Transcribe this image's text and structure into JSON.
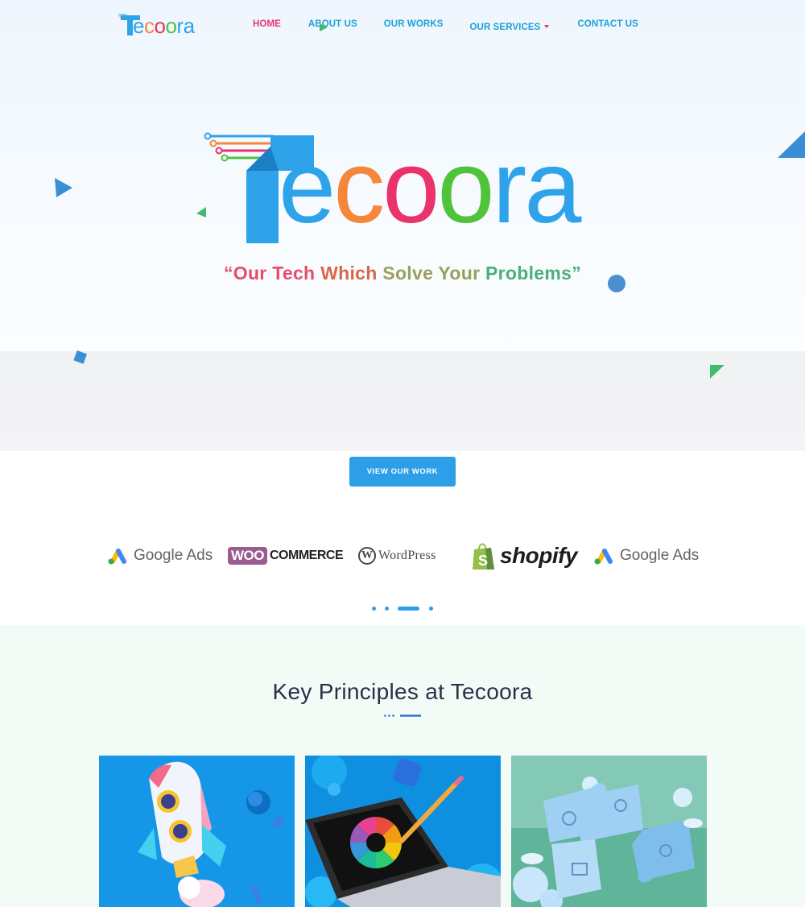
{
  "nav": {
    "logo_text": "Tecoora",
    "menu": [
      {
        "label": "HOME",
        "active": true
      },
      {
        "label": "ABOUT US",
        "active": false
      },
      {
        "label": "OUR WORKS",
        "active": false
      },
      {
        "label": "OUR SERVICES",
        "active": false,
        "has_dropdown": true
      },
      {
        "label": "CONTACT US",
        "active": false
      }
    ]
  },
  "hero": {
    "logo_text": "Tecoora",
    "tagline": "“Our Tech Which Solve Your Problems”",
    "tagline_parts": [
      "“Our Tech ",
      "Which ",
      "Solve Your ",
      "Problems”"
    ],
    "button_label": "VIEW OUR WORK"
  },
  "brands": {
    "items": [
      {
        "name": "Google Ads",
        "icon": "google-ads-icon"
      },
      {
        "name_box": "WOO",
        "name_rest": "COMMERCE",
        "icon": "woocommerce-logo"
      },
      {
        "name": "WordPress",
        "icon": "wordpress-icon"
      },
      {
        "name": "shopify",
        "icon": "shopify-bag-icon"
      },
      {
        "name": "Google Ads",
        "icon": "google-ads-icon"
      }
    ],
    "carousel": {
      "total": 4,
      "active": 3
    }
  },
  "principles": {
    "title": "Key Principles at Tecoora",
    "cards": [
      {
        "image": "rocket-illustration"
      },
      {
        "image": "laptop-color-wheel-illustration"
      },
      {
        "image": "puzzle-pieces-illustration"
      }
    ]
  },
  "colors": {
    "accent_blue": "#2d9ee8",
    "nav_active": "#e8356d",
    "nav_link": "#1ba2d6",
    "logo_blue": "#2fa3ea",
    "logo_orange": "#f5873a",
    "logo_pink": "#e9336a",
    "logo_green": "#4fc43b",
    "principles_bg": "#f3fbf6"
  }
}
